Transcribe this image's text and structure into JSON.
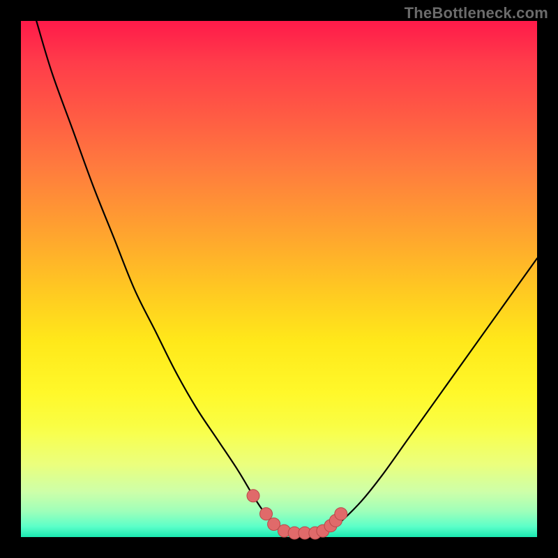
{
  "watermark": {
    "text": "TheBottleneck.com"
  },
  "colors": {
    "curve": "#000000",
    "marker_fill": "#e06a6a",
    "marker_stroke": "#b84848",
    "gradient_top": "#ff1a4a",
    "gradient_bottom": "#00e6a8"
  },
  "chart_data": {
    "type": "line",
    "title": "",
    "xlabel": "",
    "ylabel": "",
    "xlim": [
      0,
      100
    ],
    "ylim": [
      0,
      100
    ],
    "grid": false,
    "series": [
      {
        "name": "bottleneck-curve-left",
        "x": [
          3,
          6,
          10,
          14,
          18,
          22,
          26,
          30,
          34,
          38,
          42,
          45,
          47,
          49,
          51,
          53
        ],
        "values": [
          100,
          90,
          79,
          68,
          58,
          48,
          40,
          32,
          25,
          19,
          13,
          8,
          5,
          3,
          1.5,
          0.8
        ]
      },
      {
        "name": "bottleneck-curve-right",
        "x": [
          53,
          56,
          58,
          60,
          62,
          66,
          70,
          75,
          80,
          85,
          90,
          95,
          100
        ],
        "values": [
          0.8,
          0.8,
          0.8,
          1.5,
          3,
          7,
          12,
          19,
          26,
          33,
          40,
          47,
          54
        ]
      }
    ],
    "markers": {
      "name": "highlighted-data-points",
      "x": [
        45,
        47.5,
        49,
        51,
        53,
        55,
        57,
        58.5,
        60,
        61,
        62
      ],
      "values": [
        8,
        4.5,
        2.5,
        1.2,
        0.8,
        0.8,
        0.8,
        1.2,
        2.2,
        3.2,
        4.5
      ]
    }
  }
}
